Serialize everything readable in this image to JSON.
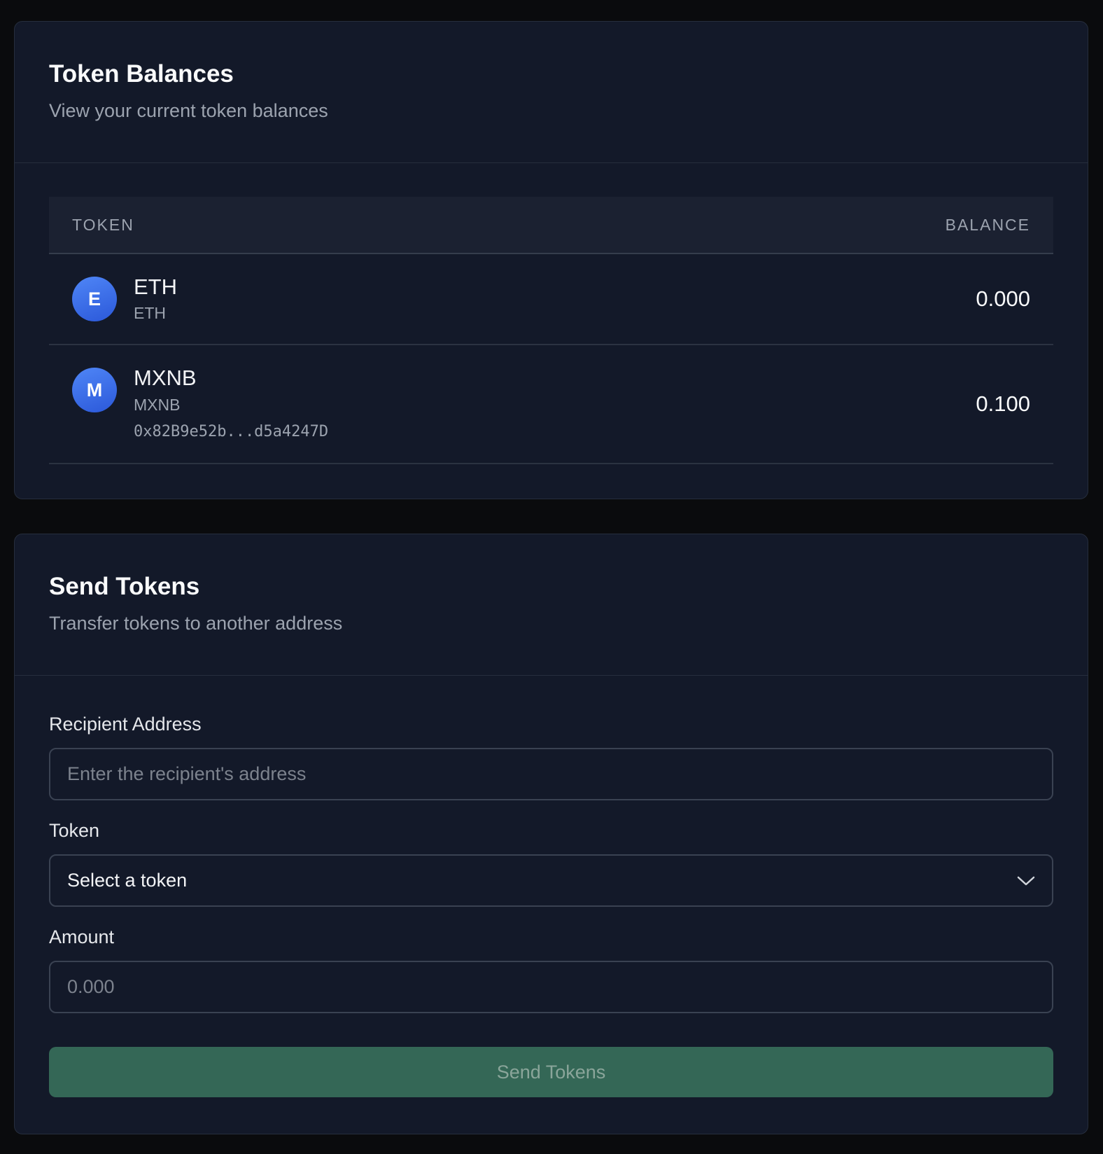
{
  "balances": {
    "title": "Token Balances",
    "subtitle": "View your current token balances",
    "columns": {
      "token": "TOKEN",
      "balance": "BALANCE"
    },
    "rows": [
      {
        "avatar_letter": "E",
        "name": "ETH",
        "symbol": "ETH",
        "address": "",
        "balance": "0.000"
      },
      {
        "avatar_letter": "M",
        "name": "MXNB",
        "symbol": "MXNB",
        "address": "0x82B9e52b...d5a4247D",
        "balance": "0.100"
      }
    ]
  },
  "send": {
    "title": "Send Tokens",
    "subtitle": "Transfer tokens to another address",
    "recipient_label": "Recipient Address",
    "recipient_placeholder": "Enter the recipient's address",
    "token_label": "Token",
    "token_selected": "Select a token",
    "amount_label": "Amount",
    "amount_placeholder": "0.000",
    "button_label": "Send Tokens"
  },
  "icons": {
    "select_icon": "chevron-down-icon"
  },
  "colors": {
    "accent_button": "#346756",
    "avatar": "#3b6fe8",
    "card_bg": "#131929",
    "page_bg": "#0a0b0d"
  }
}
